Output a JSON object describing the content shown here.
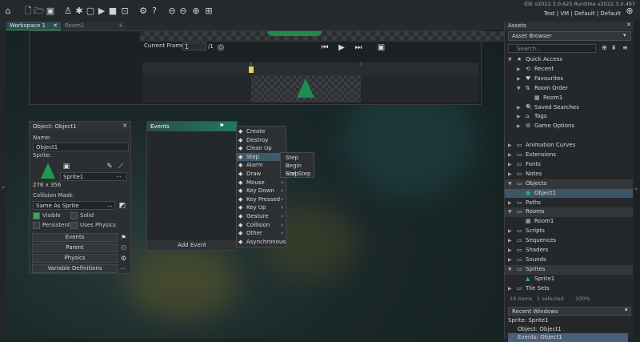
{
  "toolbar": {
    "version": "IDE v2022.3.0.625  Runtime v2022.3.0.497",
    "user_info": "Test | VM | Default | Default"
  },
  "tabs": [
    {
      "label": "Workspace 1",
      "close": "✕"
    },
    {
      "label": "Room1"
    },
    {
      "label": "+"
    }
  ],
  "room_editor": {
    "current_frame_label": "Current Frame:",
    "current_frame_value": "1",
    "frame_total": "/1",
    "tick_0": "0",
    "tick_1": "1"
  },
  "object_panel": {
    "title": "Object: Object1",
    "name_label": "Name:",
    "name_value": "Object1",
    "sprite_label": "Sprite:",
    "sprite_value": "Sprite1",
    "sprite_size": "276 x 356",
    "collision_label": "Collision Mask:",
    "collision_value": "Same As Sprite",
    "visible_label": "Visible",
    "solid_label": "Solid",
    "persistent_label": "Persistent",
    "uses_physics_label": "Uses Physics",
    "buttons": [
      "Events",
      "Parent",
      "Physics",
      "Variable Definitions"
    ],
    "more": "..."
  },
  "events_panel": {
    "title": "Events",
    "add_event": "Add Event"
  },
  "context_menu": {
    "items": [
      {
        "label": "Create",
        "icon": "lightbulb-icon"
      },
      {
        "label": "Destroy",
        "icon": "trash-icon"
      },
      {
        "label": "Clean Up",
        "icon": "broom-icon"
      },
      {
        "label": "Step",
        "icon": "footsteps-icon",
        "sub": true,
        "selected": true
      },
      {
        "label": "Alarm",
        "icon": "clock-icon",
        "sub": true
      },
      {
        "label": "Draw",
        "icon": "pencil-icon",
        "sub": true
      },
      {
        "label": "Mouse",
        "icon": "mouse-icon",
        "sub": true
      },
      {
        "label": "Key Down",
        "icon": "keyboard-icon",
        "sub": true
      },
      {
        "label": "Key Pressed",
        "icon": "keyboard-icon",
        "sub": true
      },
      {
        "label": "Key Up",
        "icon": "keyboard-icon",
        "sub": true
      },
      {
        "label": "Gesture",
        "icon": "hand-icon",
        "sub": true
      },
      {
        "label": "Collision",
        "icon": "collision-icon",
        "sub": true
      },
      {
        "label": "Other",
        "icon": "light-icon",
        "sub": true
      },
      {
        "label": "Asynchronous",
        "icon": "async-icon",
        "sub": true
      }
    ],
    "step_submenu": [
      "Step",
      "Begin Step",
      "End Step"
    ]
  },
  "assets": {
    "header": "Assets",
    "browser": "Asset Browser",
    "search_placeholder": "Search...",
    "tree": [
      {
        "label": "Quick Access",
        "indent": 0,
        "exp": "▼",
        "icon": "★"
      },
      {
        "label": "Recent",
        "indent": 1,
        "exp": "▶",
        "icon": "⟲"
      },
      {
        "label": "Favourites",
        "indent": 1,
        "exp": "▶",
        "icon": "♥"
      },
      {
        "label": "Room Order",
        "indent": 1,
        "exp": "▼",
        "icon": "⇅"
      },
      {
        "label": "Room1",
        "indent": 2,
        "exp": "",
        "icon": "▦"
      },
      {
        "label": "Saved Searches",
        "indent": 1,
        "exp": "▶",
        "icon": "🔍"
      },
      {
        "label": "Tags",
        "indent": 1,
        "exp": "▶",
        "icon": "⌂"
      },
      {
        "label": "Game Options",
        "indent": 1,
        "exp": "▶",
        "icon": "⚙"
      },
      {
        "label": "",
        "indent": 0,
        "exp": "",
        "icon": ""
      },
      {
        "label": "Animation Curves",
        "indent": 0,
        "exp": "▶",
        "icon": "▭"
      },
      {
        "label": "Extensions",
        "indent": 0,
        "exp": "▶",
        "icon": "▭"
      },
      {
        "label": "Fonts",
        "indent": 0,
        "exp": "▶",
        "icon": "▭"
      },
      {
        "label": "Notes",
        "indent": 0,
        "exp": "▶",
        "icon": "▭"
      },
      {
        "label": "Objects",
        "indent": 0,
        "exp": "▼",
        "icon": "▭",
        "grp": true
      },
      {
        "label": "Object1",
        "indent": 1,
        "exp": "",
        "icon": "●",
        "sel": true
      },
      {
        "label": "Paths",
        "indent": 0,
        "exp": "▶",
        "icon": "▭"
      },
      {
        "label": "Rooms",
        "indent": 0,
        "exp": "▼",
        "icon": "▭",
        "grp": true
      },
      {
        "label": "Room1",
        "indent": 1,
        "exp": "",
        "icon": "▦"
      },
      {
        "label": "Scripts",
        "indent": 0,
        "exp": "▶",
        "icon": "▭"
      },
      {
        "label": "Sequences",
        "indent": 0,
        "exp": "▶",
        "icon": "▭"
      },
      {
        "label": "Shaders",
        "indent": 0,
        "exp": "▶",
        "icon": "▭"
      },
      {
        "label": "Sounds",
        "indent": 0,
        "exp": "▶",
        "icon": "▭"
      },
      {
        "label": "Sprites",
        "indent": 0,
        "exp": "▼",
        "icon": "▭",
        "grp": true
      },
      {
        "label": "Sprite1",
        "indent": 1,
        "exp": "",
        "icon": "▲"
      },
      {
        "label": "Tile Sets",
        "indent": 0,
        "exp": "▶",
        "icon": "▭"
      }
    ],
    "footer_items": "18 items",
    "footer_selected": "1 selected",
    "zoom": "100%"
  },
  "recent_windows": {
    "title": "Recent Windows",
    "items": [
      "Sprite: Sprite1",
      "Object: Object1",
      "Events: Object1"
    ]
  }
}
